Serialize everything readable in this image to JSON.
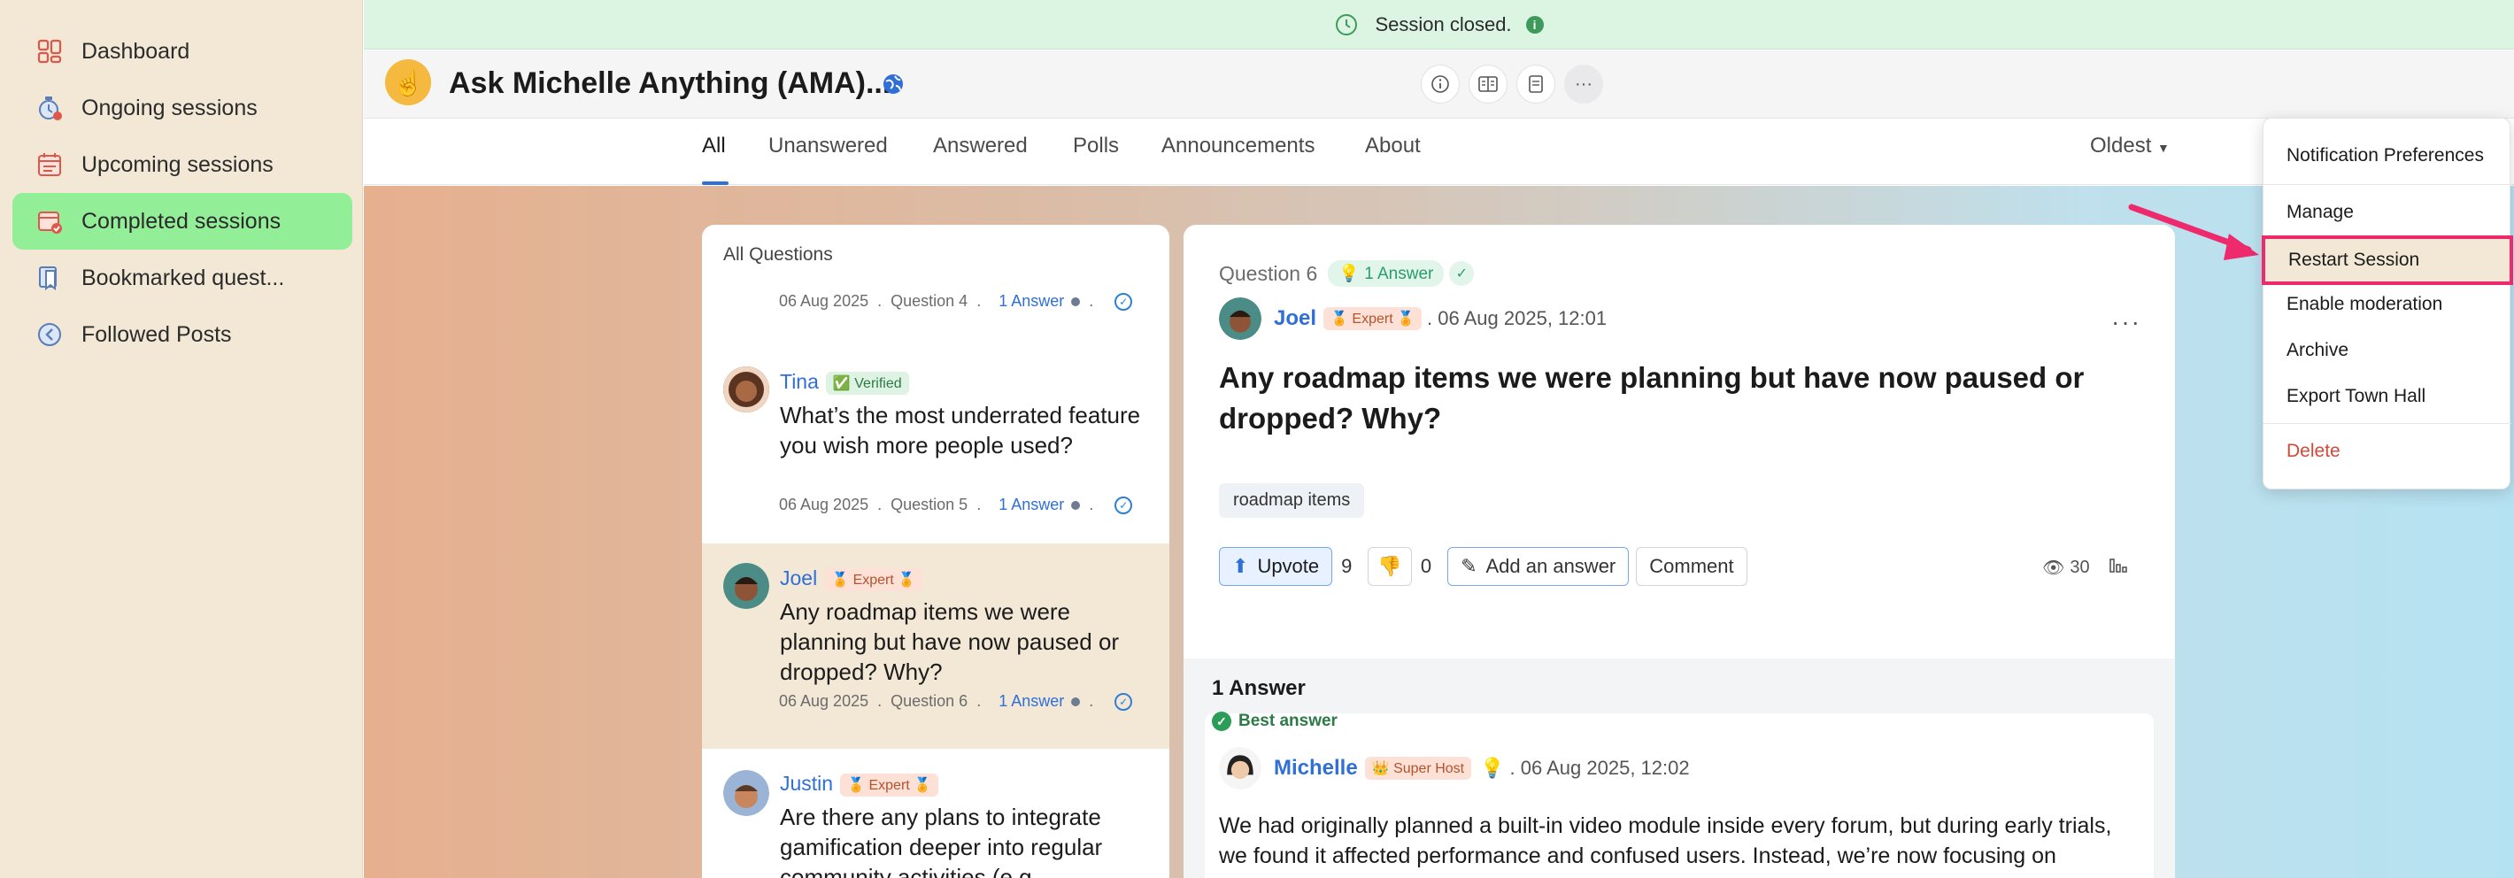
{
  "sidebar": {
    "items": [
      {
        "label": "Dashboard",
        "icon": "grid-icon"
      },
      {
        "label": "Ongoing sessions",
        "icon": "timer-icon"
      },
      {
        "label": "Upcoming sessions",
        "icon": "calendar-icon"
      },
      {
        "label": "Completed sessions",
        "icon": "calendar-check-icon",
        "active": true
      },
      {
        "label": "Bookmarked quest...",
        "icon": "bookmark-icon"
      },
      {
        "label": "Followed Posts",
        "icon": "arrow-left-circle-icon"
      }
    ]
  },
  "banner": {
    "text": "Session closed."
  },
  "header": {
    "title": "Ask Michelle Anything (AMA)..."
  },
  "tabs": {
    "items": [
      "All",
      "Unanswered",
      "Answered",
      "Polls",
      "Announcements",
      "About"
    ],
    "sort": "Oldest"
  },
  "question_list": {
    "title": "All Questions",
    "sep": ".",
    "items": [
      {
        "date": "06 Aug 2025",
        "number": "Question 4",
        "answers": "1 Answer"
      },
      {
        "name": "Tina",
        "badge": "Verified",
        "text": "What’s the most underrated feature you wish more people used?",
        "date": "06 Aug 2025",
        "number": "Question 5",
        "answers": "1 Answer"
      },
      {
        "name": "Joel",
        "badge": "Expert",
        "text": "Any roadmap items we were planning but have now paused or dropped? Why?",
        "date": "06 Aug 2025",
        "number": "Question 6",
        "answers": "1 Answer"
      },
      {
        "name": "Justin",
        "badge": "Expert",
        "text": "Are there any plans to integrate gamification deeper into regular community activities (e.g."
      }
    ]
  },
  "detail": {
    "label": "Question 6",
    "answer_pill": "1 Answer",
    "author": "Joel",
    "author_badge": "Expert",
    "timestamp": ". 06 Aug 2025, 12:01",
    "question": "Any roadmap items we were planning but have now paused or dropped? Why?",
    "tag": "roadmap items",
    "upvote_label": "Upvote",
    "upvotes": "9",
    "downvotes": "0",
    "add_answer_label": "Add an answer",
    "comment_label": "Comment",
    "views": "30",
    "answers_title": "1 Answer",
    "best_answer_label": "Best answer",
    "answer_author": "Michelle",
    "answer_author_badge": "Super Host",
    "answer_timestamp": ". 06 Aug 2025, 12:02",
    "answer_text": "We had originally planned a built-in video module inside every forum, but during early trials, we found it affected performance and confused users. Instead, we’re now focusing on"
  },
  "menu": {
    "items": [
      "Notification Preferences",
      "Manage",
      "Restart Session",
      "Enable moderation",
      "Archive",
      "Export Town Hall",
      "Delete"
    ]
  },
  "colors": {
    "accent": "#2f6fd6",
    "highlight": "#ee2a6d",
    "active_nav": "#93ee98"
  }
}
